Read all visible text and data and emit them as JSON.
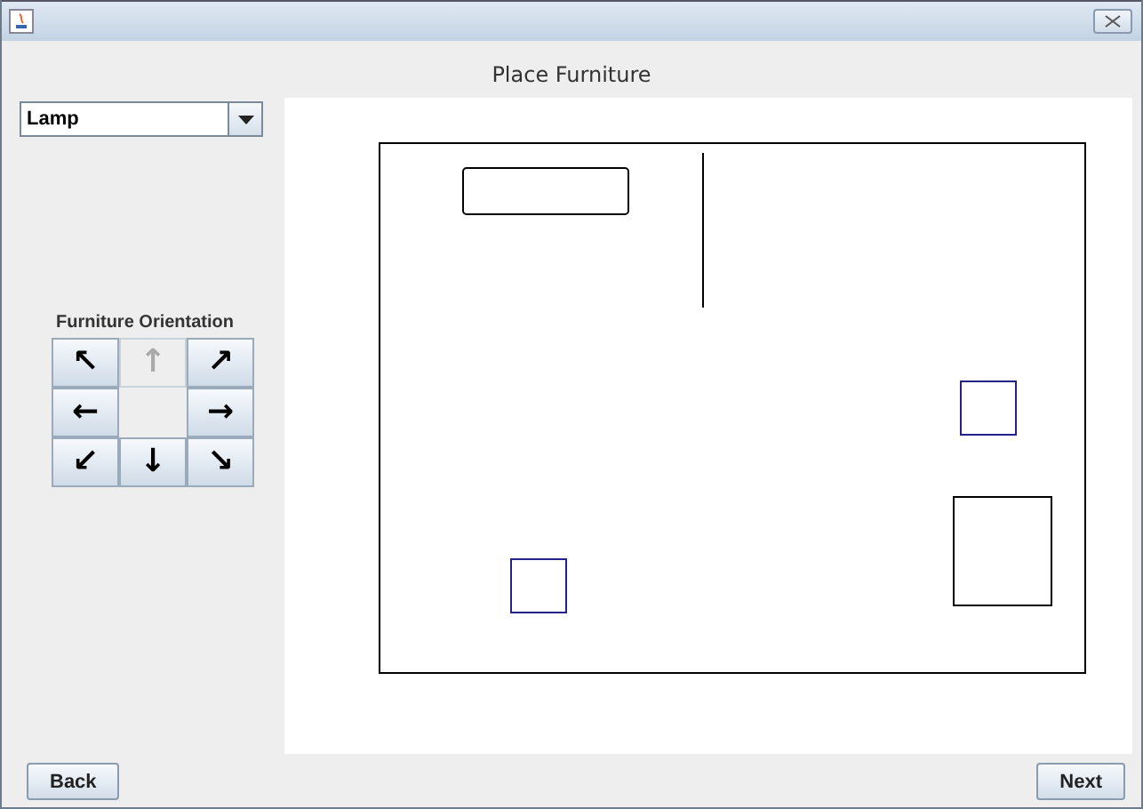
{
  "window": {
    "title": "Place Furniture"
  },
  "furniture_select": {
    "value": "Lamp"
  },
  "orientation": {
    "label": "Furniture Orientation",
    "buttons": [
      {
        "glyph": "↖",
        "disabled": false
      },
      {
        "glyph": "↑",
        "disabled": true
      },
      {
        "glyph": "↗",
        "disabled": false
      },
      {
        "glyph": "←",
        "disabled": false
      },
      {
        "kind": "empty"
      },
      {
        "glyph": "→",
        "disabled": false
      },
      {
        "glyph": "↙",
        "disabled": false
      },
      {
        "glyph": "↓",
        "disabled": false
      },
      {
        "glyph": "↘",
        "disabled": false
      }
    ]
  },
  "buttons": {
    "back": "Back",
    "next": "Next"
  }
}
